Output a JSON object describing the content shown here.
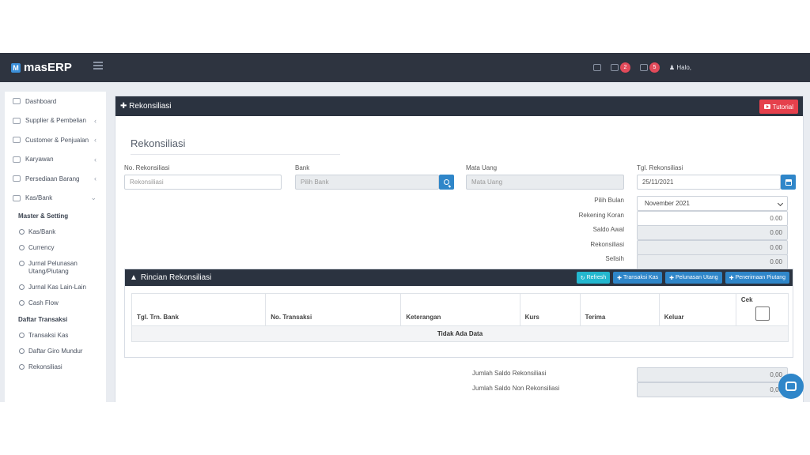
{
  "app": {
    "brand": "masERP",
    "brand_mark": "M",
    "greeting": "Halo,"
  },
  "topbar": {
    "badge_messages": "2",
    "badge_calendar": "5"
  },
  "sidebar": {
    "items": [
      {
        "label": "Dashboard",
        "icon": "home-icon"
      },
      {
        "label": "Supplier & Pembelian",
        "icon": "cart-icon"
      },
      {
        "label": "Customer & Penjualan",
        "icon": "credit-card-icon"
      },
      {
        "label": "Karyawan",
        "icon": "id-card-icon"
      },
      {
        "label": "Persediaan Barang",
        "icon": "tag-icon"
      },
      {
        "label": "Kas/Bank",
        "icon": "wallet-icon"
      }
    ],
    "group_master": "Master & Setting",
    "master_items": [
      "Kas/Bank",
      "Currency",
      "Jurnal Pelunasan Utang/Piutang",
      "Jurnal Kas Lain-Lain",
      "Cash Flow"
    ],
    "group_transaksi": "Daftar Transaksi",
    "transaksi_items": [
      "Transaksi Kas",
      "Daftar Giro Mundur",
      "Rekonsiliasi"
    ]
  },
  "panel": {
    "title": "Rekonsiliasi",
    "tutorial_label": "Tutorial",
    "form_title": "Rekonsiliasi"
  },
  "form": {
    "no_label": "No. Rekonsiliasi",
    "no_placeholder": "Rekonsiliasi",
    "bank_label": "Bank",
    "bank_placeholder": "Pilih Bank",
    "currency_label": "Mata Uang",
    "currency_placeholder": "Mata Uang",
    "date_label": "Tgl. Rekonsiliasi",
    "date_value": "25/11/2021",
    "month_label": "Pilih Bulan",
    "month_value": "November 2021",
    "rekening_label": "Rekening Koran",
    "rekening_value": "0.00",
    "saldo_awal_label": "Saldo Awal",
    "saldo_awal_value": "0.00",
    "rekonsiliasi_label": "Rekonsiliasi",
    "rekonsiliasi_value": "0.00",
    "selisih_label": "Selisih",
    "selisih_value": "0.00"
  },
  "detail": {
    "title": "Rincian Rekonsiliasi",
    "buttons": {
      "refresh": "Refresh",
      "transaksi_kas": "Transaksi Kas",
      "pelunasan_utang": "Pelunasan Utang",
      "penerimaan_piutang": "Penerimaan Piutang"
    },
    "columns": [
      "Tgl. Trn. Bank",
      "No. Transaksi",
      "Keterangan",
      "Kurs",
      "Terima",
      "Keluar",
      "Cek"
    ],
    "empty_text": "Tidak Ada Data"
  },
  "totals": {
    "saldo_rekonsiliasi_label": "Jumlah Saldo Rekonsiliasi",
    "saldo_rekonsiliasi_value": "0,00",
    "saldo_non_label": "Jumlah Saldo Non Rekonsiliasi",
    "saldo_non_value": "0,00"
  },
  "colors": {
    "topbar": "#2e3440",
    "accent": "#2f86c9",
    "danger": "#e5404c",
    "cyan": "#23b7cf"
  }
}
